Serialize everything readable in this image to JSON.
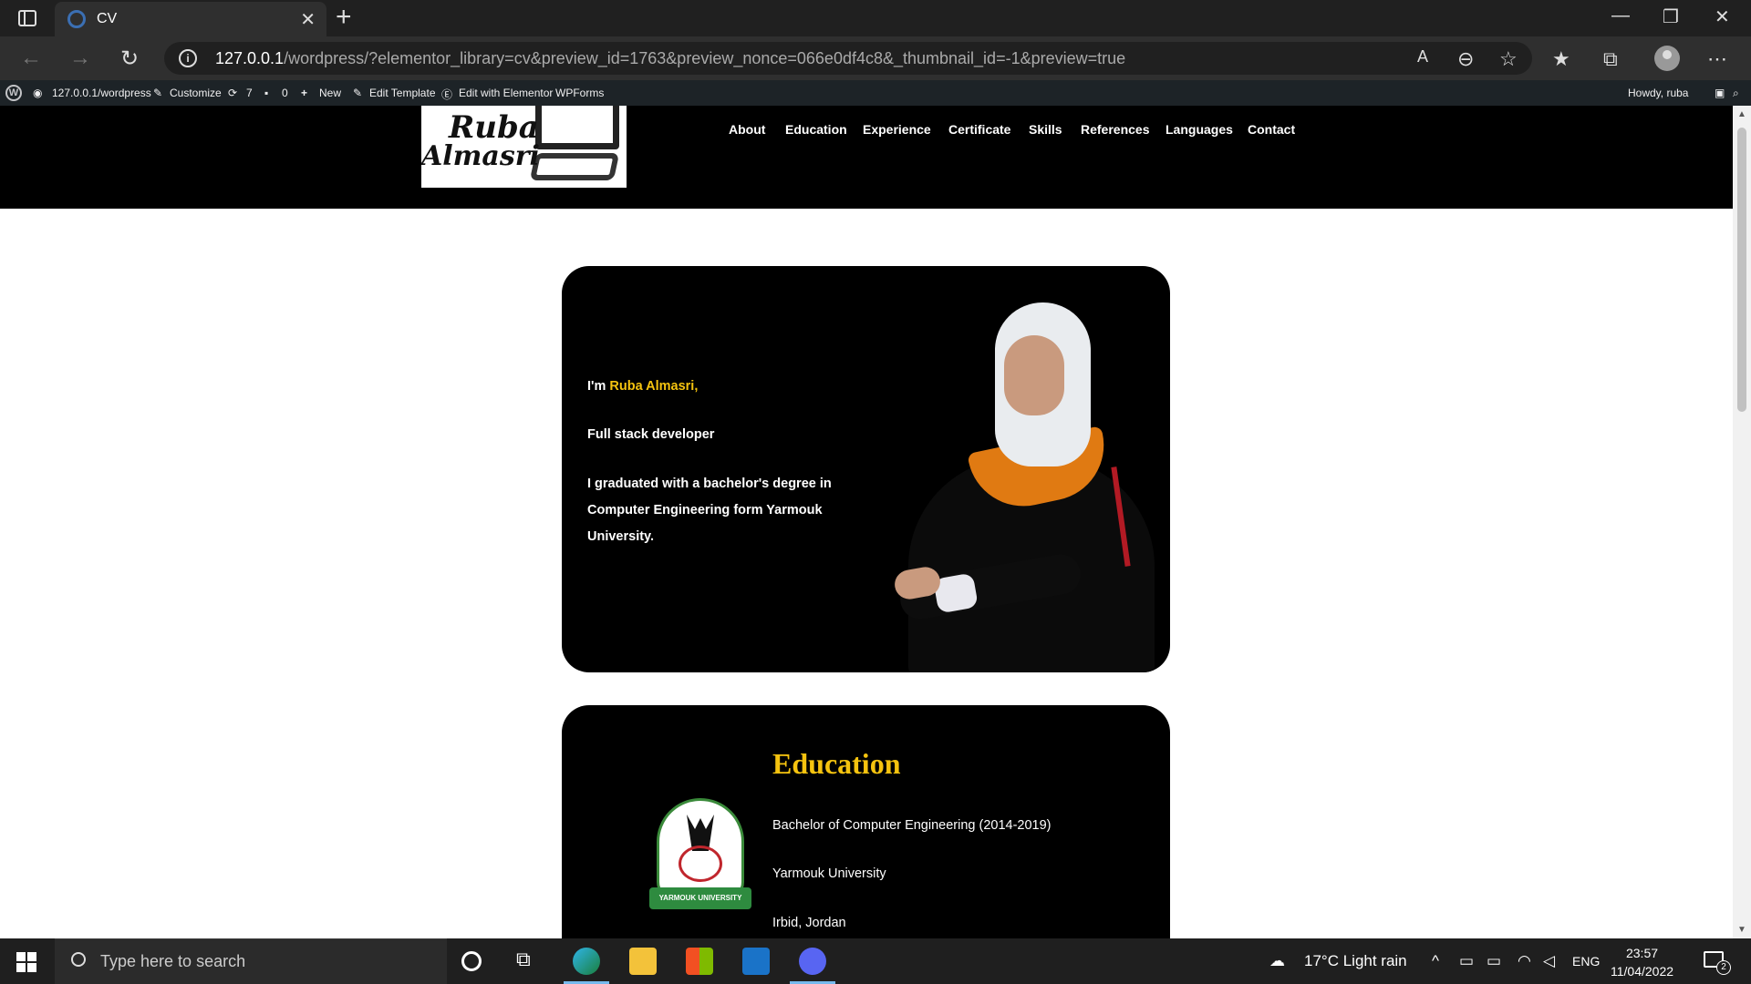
{
  "browser": {
    "tab_title": "CV",
    "url_host": "127.0.0.1",
    "url_rest": "/wordpress/?elementor_library=cv&preview_id=1763&preview_nonce=066e0df4c8&_thumbnail_id=-1&preview=true"
  },
  "admin_bar": {
    "site": "127.0.0.1/wordpress",
    "customize": "Customize",
    "updates": "7",
    "comments": "0",
    "new": "New",
    "edit_template": "Edit Template",
    "edit_elementor": "Edit with Elementor",
    "wpforms": "WPForms",
    "howdy": "Howdy, ruba"
  },
  "logo": {
    "line1": "Ruba",
    "line2": "Almasri"
  },
  "menu": [
    "About",
    "Education",
    "Experience",
    "Certificate",
    "Skills",
    "References",
    "Languages",
    "Contact"
  ],
  "hero": {
    "intro_prefix": "I'm ",
    "name": "Ruba Almasri,",
    "role": "Full stack developer",
    "bio_1": "I graduated with a bachelor's degree in",
    "bio_2": "Computer Engineering form Yarmouk",
    "bio_3": "University."
  },
  "education": {
    "heading": "Education",
    "degree": "Bachelor of Computer Engineering (2014-2019)",
    "university": "Yarmouk University",
    "location": "Irbid, Jordan",
    "emblem_text": "YARMOUK UNIVERSITY"
  },
  "taskbar": {
    "search_placeholder": "Type here to search",
    "weather": "17°C  Light rain",
    "lang": "ENG",
    "time": "23:57",
    "date": "11/04/2022",
    "notifications": "2"
  },
  "colors": {
    "accent": "#f5c30f",
    "card": "#000000"
  }
}
